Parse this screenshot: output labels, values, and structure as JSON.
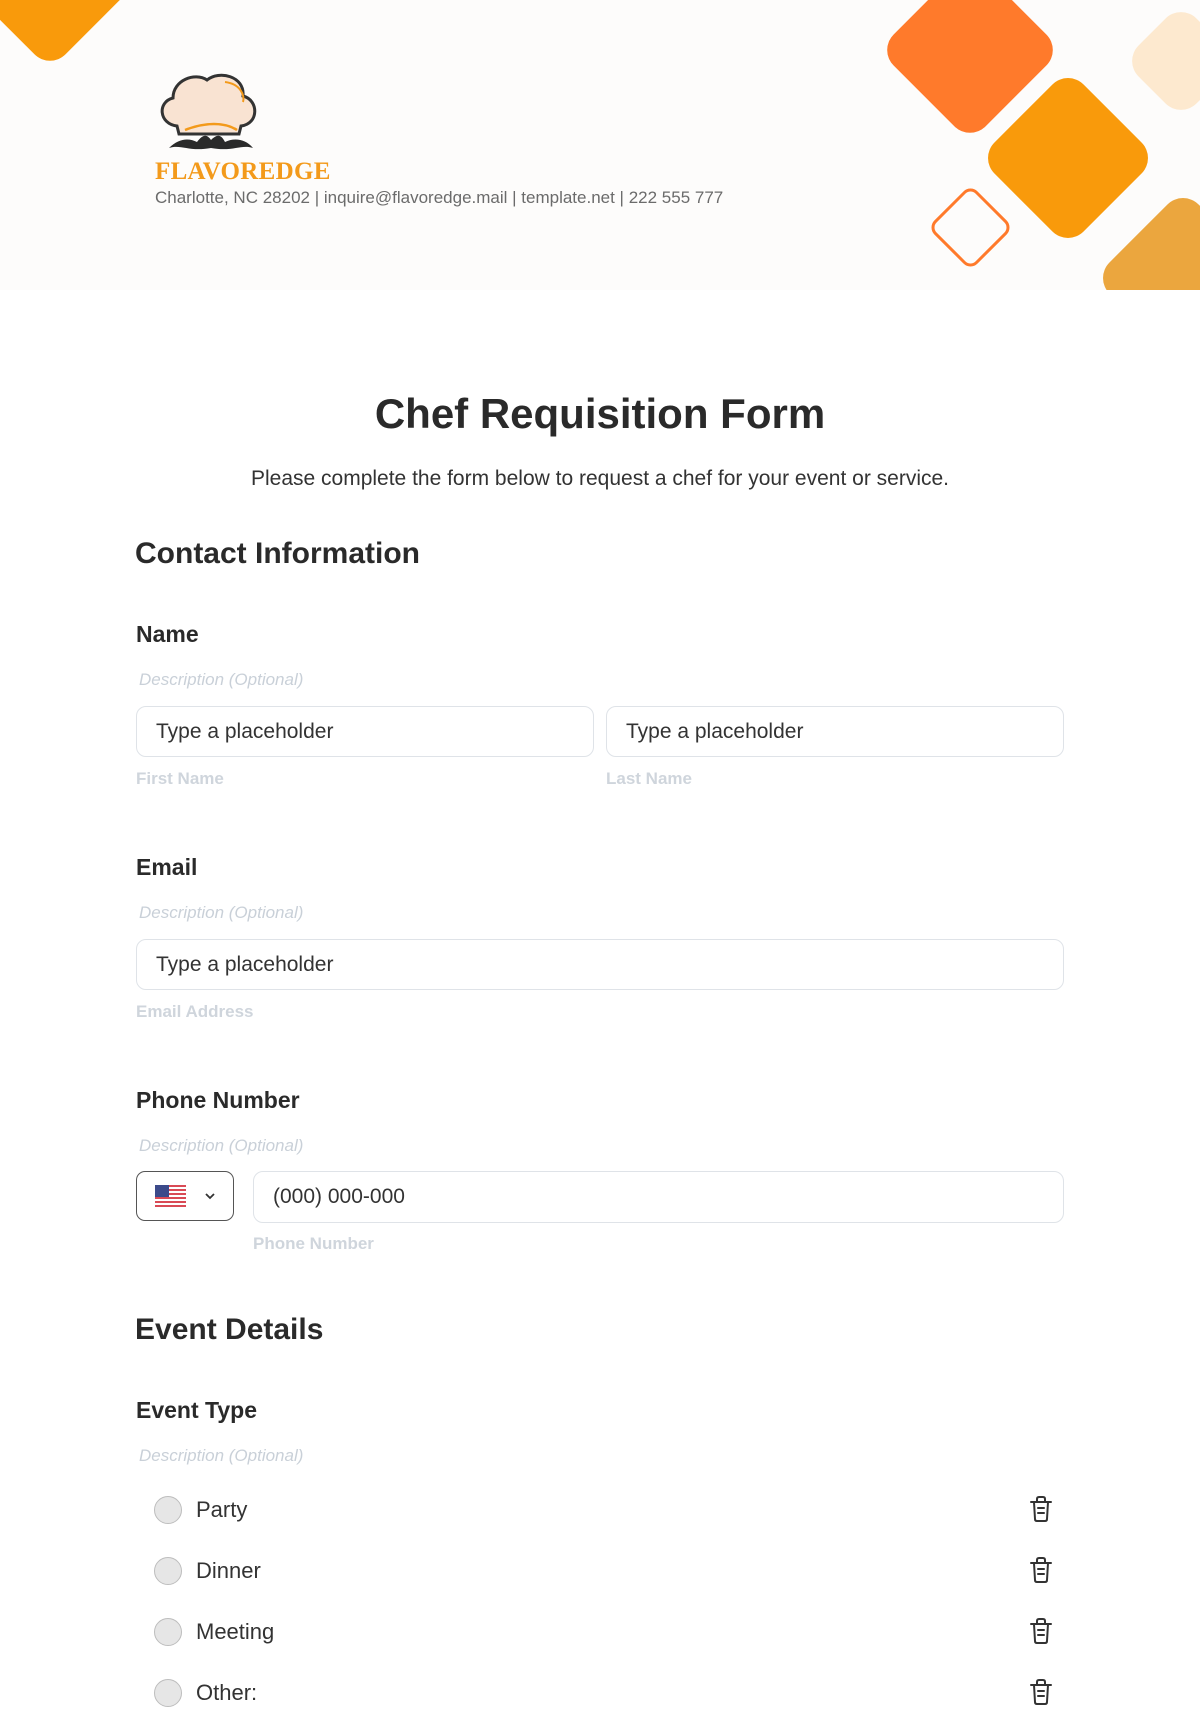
{
  "header": {
    "brand_name": "FLAVOREDGE",
    "contact_line": "Charlotte, NC 28202 | inquire@flavoredge.mail | template.net | 222 555 777",
    "logo_icon": "chef-hat-mustache-icon",
    "colors": {
      "orange": "#ff7a2b",
      "amber": "#f99a0b",
      "peach": "#fde9cf",
      "gold": "#eba63e",
      "brand_text": "#f39a1b"
    }
  },
  "form": {
    "title": "Chef Requisition Form",
    "subtitle": "Please complete the form below to request a chef for your event or service."
  },
  "sections": {
    "contact": {
      "heading": "Contact Information",
      "name": {
        "label": "Name",
        "description": "Description (Optional)",
        "first": {
          "placeholder": "Type a placeholder",
          "sublabel": "First Name"
        },
        "last": {
          "placeholder": "Type a placeholder",
          "sublabel": "Last Name"
        }
      },
      "email": {
        "label": "Email",
        "description": "Description (Optional)",
        "placeholder": "Type a placeholder",
        "sublabel": "Email Address"
      },
      "phone": {
        "label": "Phone Number",
        "description": "Description (Optional)",
        "country_icon": "us-flag-icon",
        "placeholder": "(000) 000-000",
        "sublabel": "Phone Number"
      }
    },
    "event": {
      "heading": "Event Details",
      "event_type": {
        "label": "Event Type",
        "description": "Description (Optional)",
        "options": [
          {
            "label": "Party"
          },
          {
            "label": "Dinner"
          },
          {
            "label": "Meeting"
          },
          {
            "label": "Other:"
          }
        ]
      }
    }
  }
}
